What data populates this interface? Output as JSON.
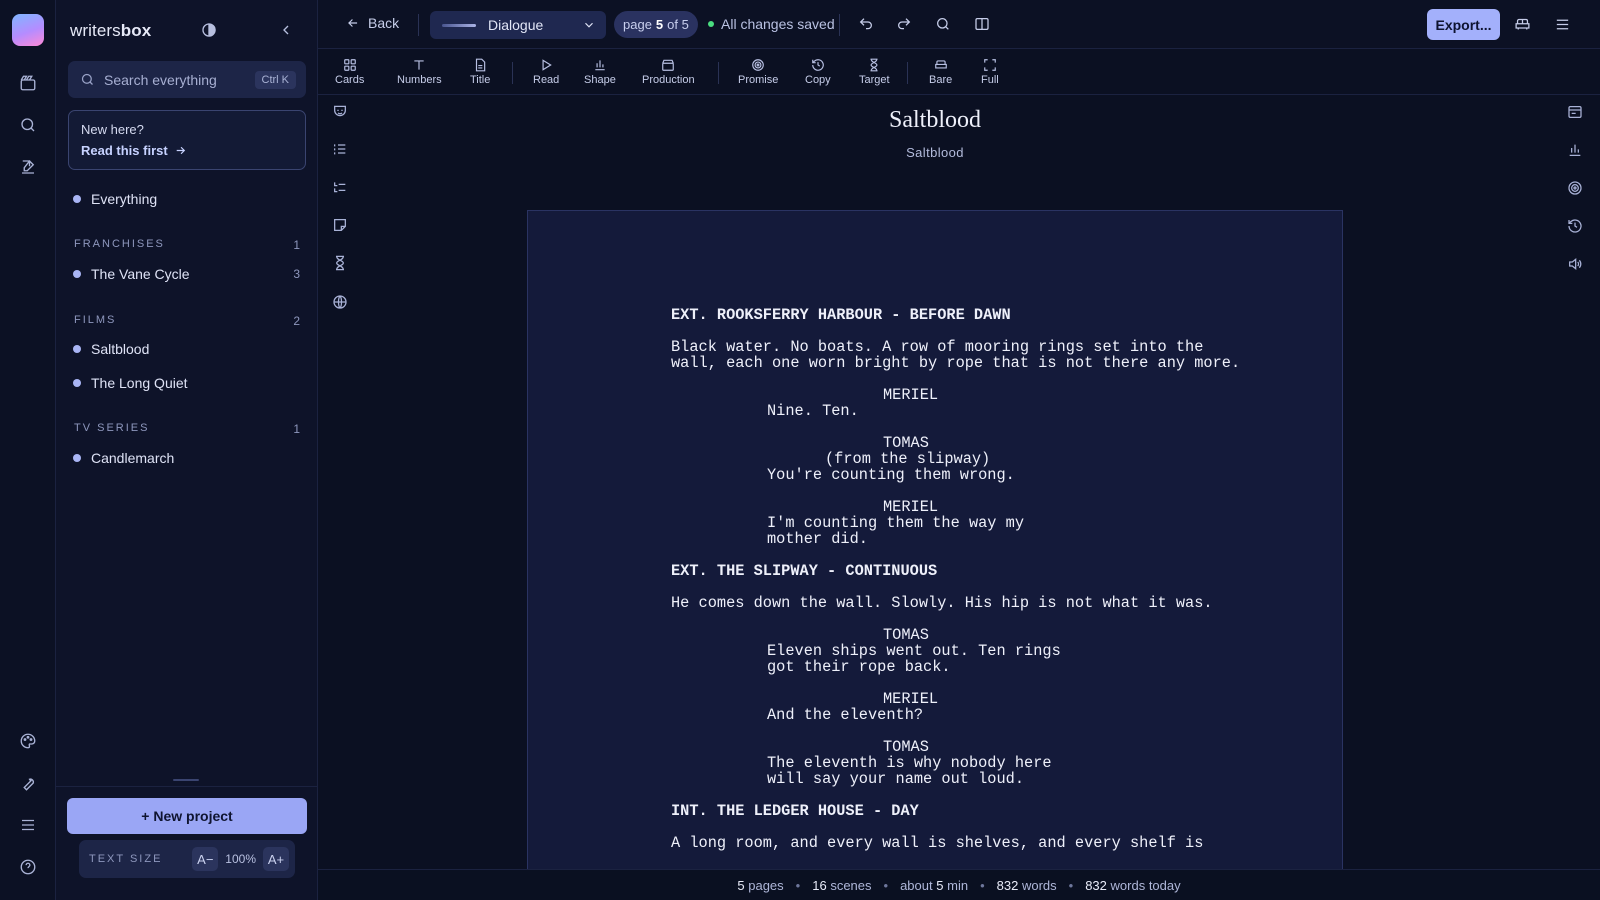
{
  "app": {
    "brand_light": "writers",
    "brand_bold": "box"
  },
  "rail": {
    "top_icons": [
      "film-icon",
      "search-icon",
      "edit-icon"
    ],
    "bottom_icons": [
      "palette-icon",
      "wrench-icon",
      "menu-icon",
      "help-icon"
    ]
  },
  "sidebar": {
    "search_placeholder": "Search everything",
    "search_shortcut": "Ctrl K",
    "newhere_title": "New here?",
    "newhere_link": "Read this first",
    "everything": "Everything",
    "sections": [
      {
        "title": "FRANCHISES",
        "count": "1",
        "items": [
          {
            "label": "The Vane Cycle",
            "count": "3"
          }
        ]
      },
      {
        "title": "FILMS",
        "count": "2",
        "items": [
          {
            "label": "Saltblood",
            "count": ""
          },
          {
            "label": "The Long Quiet",
            "count": ""
          }
        ]
      },
      {
        "title": "TV SERIES",
        "count": "1",
        "items": [
          {
            "label": "Candlemarch",
            "count": ""
          }
        ]
      }
    ],
    "new_project": "+ New project",
    "text_size_label": "TEXT SIZE",
    "text_size_dec": "A−",
    "text_size_value": "100%",
    "text_size_inc": "A+"
  },
  "topbar": {
    "back": "Back",
    "element_type": "Dialogue",
    "page_prefix": "page",
    "page_current": "5",
    "page_suffix": "of 5",
    "saved": "All changes saved",
    "export": "Export..."
  },
  "toolbar": {
    "tools": [
      "Cards",
      "Numbers",
      "Title",
      "Read",
      "Shape",
      "Production",
      "Promise",
      "Copy",
      "Target",
      "Bare",
      "Full"
    ]
  },
  "document": {
    "title": "Saltblood",
    "subtitle": "Saltblood",
    "script": [
      {
        "kind": "sh",
        "text": "EXT. ROOKSFERRY HARBOUR - BEFORE DAWN"
      },
      {
        "kind": "act",
        "text": "Black water. No boats. A row of mooring rings set into the wall, each one worn bright by rope that is not there any more."
      },
      {
        "kind": "cue",
        "text": "MERIEL"
      },
      {
        "kind": "dlg",
        "text": "Nine. Ten."
      },
      {
        "kind": "cue",
        "text": "TOMAS"
      },
      {
        "kind": "par",
        "text": "(from the slipway)"
      },
      {
        "kind": "dlg",
        "text": "You're counting them wrong."
      },
      {
        "kind": "cue",
        "text": "MERIEL"
      },
      {
        "kind": "dlg",
        "text": "I'm counting them the way my mother did."
      },
      {
        "kind": "sh",
        "text": "EXT. THE SLIPWAY - CONTINUOUS"
      },
      {
        "kind": "act",
        "text": "He comes down the wall. Slowly. His hip is not what it was."
      },
      {
        "kind": "cue",
        "text": "TOMAS"
      },
      {
        "kind": "dlg",
        "text": "Eleven ships went out. Ten rings got their rope back."
      },
      {
        "kind": "cue",
        "text": "MERIEL"
      },
      {
        "kind": "dlg",
        "text": "And the eleventh?"
      },
      {
        "kind": "cue",
        "text": "TOMAS"
      },
      {
        "kind": "dlg",
        "text": "The eleventh is why nobody here will say your name out loud."
      },
      {
        "kind": "sh",
        "text": "INT. THE LEDGER HOUSE - DAY"
      },
      {
        "kind": "act",
        "text": "A long room, and every wall is shelves, and every shelf is"
      }
    ]
  },
  "status": {
    "pages": "5",
    "pages_label": "pages",
    "scenes": "16",
    "scenes_label": "scenes",
    "runtime_prefix": "about",
    "runtime": "5",
    "runtime_unit": "min",
    "words": "832",
    "words_label": "words",
    "today": "832",
    "today_label": "words today"
  }
}
